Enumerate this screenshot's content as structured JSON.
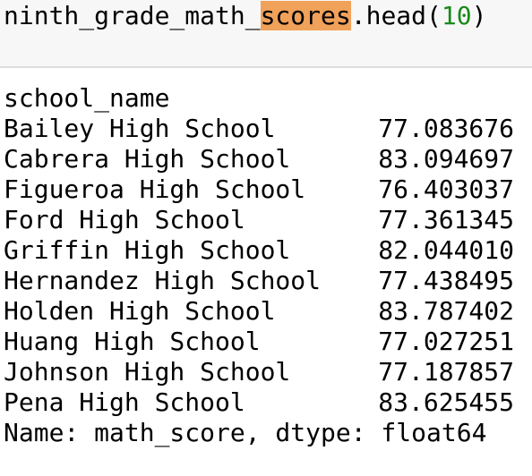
{
  "input": {
    "var_prefix": "ninth_grade_math_",
    "var_highlight": "scores",
    "method": ".head(",
    "arg": "10",
    "close": ")"
  },
  "output": {
    "index_name": "school_name",
    "rows": [
      {
        "name": "Bailey High School",
        "value": "77.083676"
      },
      {
        "name": "Cabrera High School",
        "value": "83.094697"
      },
      {
        "name": "Figueroa High School",
        "value": "76.403037"
      },
      {
        "name": "Ford High School",
        "value": "77.361345"
      },
      {
        "name": "Griffin High School",
        "value": "82.044010"
      },
      {
        "name": "Hernandez High School",
        "value": "77.438495"
      },
      {
        "name": "Holden High School",
        "value": "83.787402"
      },
      {
        "name": "Huang High School",
        "value": "77.027251"
      },
      {
        "name": "Johnson High School",
        "value": "77.187857"
      },
      {
        "name": "Pena High School",
        "value": "83.625455"
      }
    ],
    "footer": "Name: math_score, dtype: float64"
  },
  "colors": {
    "highlight": "#f0a15a",
    "number": "#1a8a1a",
    "cell_background": "#f7f7f7"
  }
}
